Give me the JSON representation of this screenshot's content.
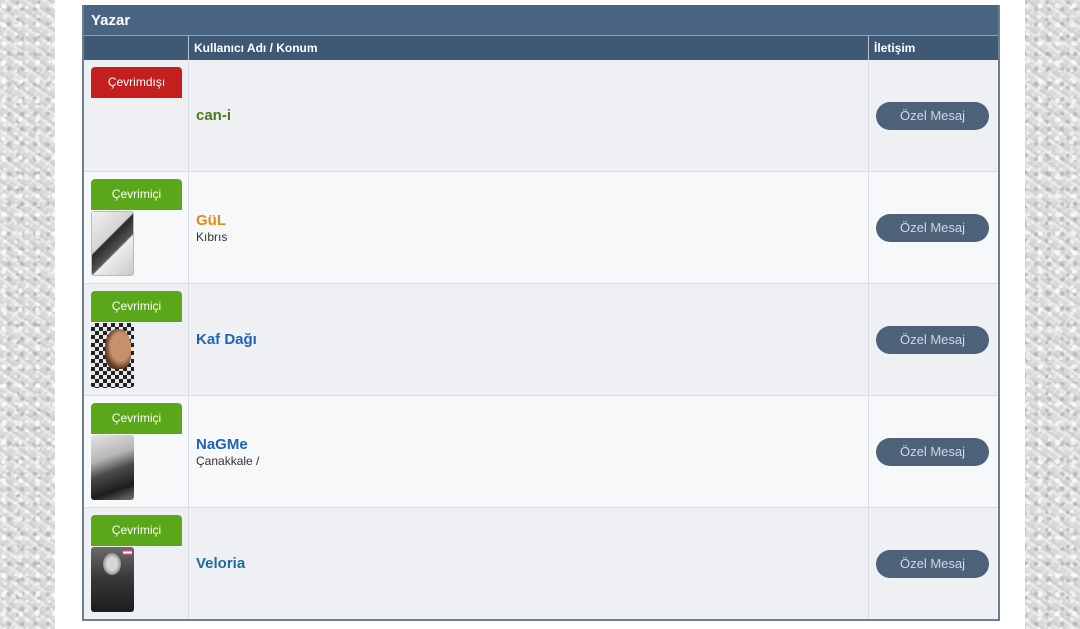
{
  "panel": {
    "title": "Yazar",
    "columns": [
      "",
      "Kullanıcı Adı / Konum",
      "İletişim"
    ]
  },
  "users": [
    {
      "status": "Çevrimdışı",
      "name": "can-i",
      "location": "",
      "button": "Özel Mesaj",
      "name_color": "#4a7a1a"
    },
    {
      "status": "Çevrimiçi",
      "name": "GüL",
      "location": "Kıbrıs",
      "button": "Özel Mesaj",
      "name_color": "#e08a1e"
    },
    {
      "status": "Çevrimiçi",
      "name": "Kaf Dağı",
      "location": "",
      "button": "Özel Mesaj",
      "name_color": "#1f63b8"
    },
    {
      "status": "Çevrimiçi",
      "name": "NaGMe",
      "location": "Çanakkale /",
      "button": "Özel Mesaj",
      "name_color": "#1f63b8"
    },
    {
      "status": "Çevrimiçi",
      "name": "Veloria",
      "location": "",
      "button": "Özel Mesaj",
      "name_color": "#1a6e9a"
    }
  ],
  "colors": {
    "header": "#4a6584",
    "online": "#5aa71a",
    "offline": "#c41f1f",
    "button": "#4d6278"
  },
  "icons": [
    "avatar-gul",
    "avatar-kaf-dagi",
    "avatar-nagme",
    "avatar-veloria"
  ]
}
